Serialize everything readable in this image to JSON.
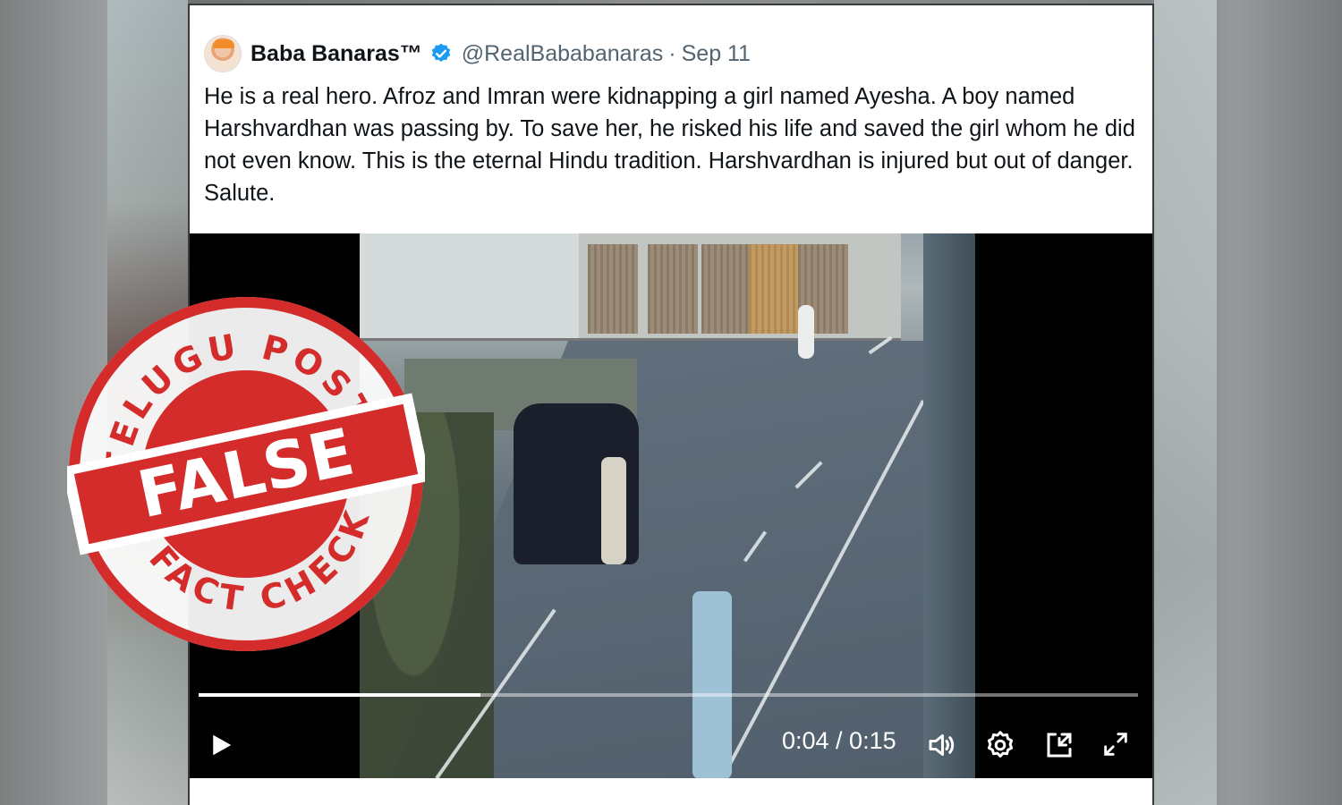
{
  "tweet": {
    "display_name": "Baba Banaras™",
    "handle": "@RealBababanaras",
    "separator": "·",
    "date": "Sep 11",
    "text": "He is a real hero. Afroz and Imran were kidnapping a girl named Ayesha. A boy named Harshvardhan was passing by. To save her, he risked his life and saved the girl whom he did not even know. This is the eternal Hindu tradition. Harshvardhan is injured but out of danger. Salute."
  },
  "video": {
    "time_display": "0:04 / 0:15",
    "current_time": "0:04",
    "duration": "0:15",
    "progress_fraction": 0.3,
    "controls": [
      "play-icon",
      "volume-icon",
      "settings-icon",
      "pip-icon",
      "fullscreen-icon"
    ]
  },
  "stamp": {
    "top_text": "TELUGU POST",
    "verdict": "FALSE",
    "bottom_text": "FACT CHECK",
    "color": "#d42b2b"
  },
  "colors": {
    "text_primary": "#0f1419",
    "text_secondary": "#536471",
    "verified_blue": "#1d9bf0"
  }
}
